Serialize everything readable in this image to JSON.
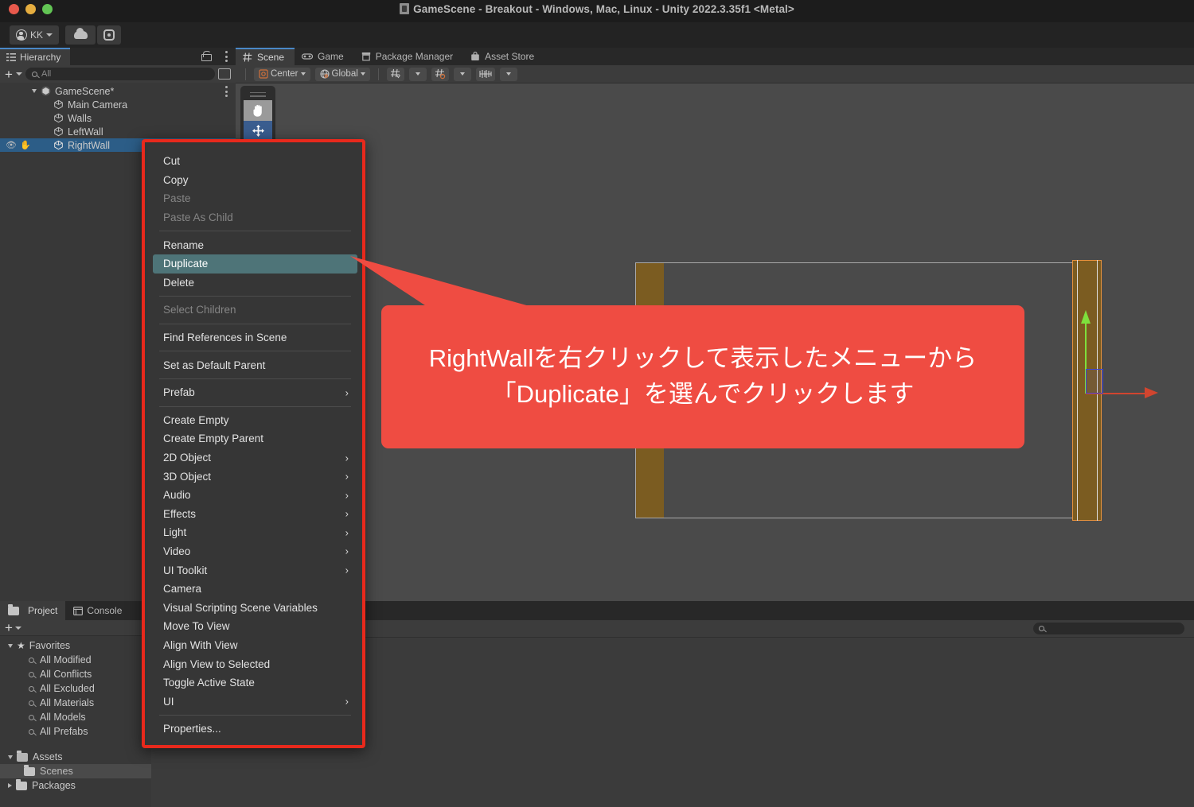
{
  "window": {
    "title": "GameScene - Breakout - Windows, Mac, Linux - Unity 2022.3.35f1 <Metal>",
    "doc_icon": "unity-document-icon"
  },
  "toolbar": {
    "account_label": "KK",
    "account_icon": "account-avatar-icon",
    "cloud_icon": "cloud-icon",
    "settings_icon": "gear-icon",
    "play_icon": "play-icon",
    "pause_icon": "pause-icon",
    "step_icon": "step-icon"
  },
  "hierarchy": {
    "tab_label": "Hierarchy",
    "tab_icon": "hierarchy-icon",
    "lock_icon": "lock-icon",
    "menu_icon": "kebab-menu-icon",
    "add_label": "+",
    "search_placeholder": "All",
    "search_value": "",
    "search_icon": "search-icon",
    "expand_icon": "open-in-new-icon",
    "items": [
      {
        "label": "GameScene*",
        "depth": 0,
        "icon": "unity-scene-icon",
        "expanded": true,
        "selected": false
      },
      {
        "label": "Main Camera",
        "depth": 1,
        "icon": "gameobject-cube-icon",
        "selected": false
      },
      {
        "label": "Walls",
        "depth": 1,
        "icon": "gameobject-cube-icon",
        "selected": false
      },
      {
        "label": "LeftWall",
        "depth": 1,
        "icon": "gameobject-cube-icon",
        "selected": false
      },
      {
        "label": "RightWall",
        "depth": 1,
        "icon": "gameobject-cube-icon",
        "selected": true
      }
    ]
  },
  "dock": {
    "tabs": [
      {
        "label": "Scene",
        "icon": "scene-grid-icon",
        "active": true
      },
      {
        "label": "Game",
        "icon": "gamepad-icon",
        "active": false
      },
      {
        "label": "Package Manager",
        "icon": "package-icon",
        "active": false
      },
      {
        "label": "Asset Store",
        "icon": "asset-store-bag-icon",
        "active": false
      }
    ],
    "scene_toolbar": {
      "pivot_mode": "Center",
      "pivot_icon": "pivot-center-icon",
      "handle_space": "Global",
      "handle_icon": "globe-icon",
      "grid_snapping_icon": "grid-snap-icon",
      "snap_increment_icon": "snap-increment-icon",
      "grid_visibility_icon": "grid-visibility-icon",
      "dropdown_icon": "chevron-down-icon"
    },
    "tool_palette": {
      "grip_icon": "drag-grip-icon",
      "hand_tool_icon": "hand-tool-icon",
      "move_tool_icon": "move-tool-icon",
      "active_tool": "move-tool"
    },
    "scene_objects": [
      {
        "name": "LeftWall",
        "color": "#7b5c21",
        "selected": false
      },
      {
        "name": "RightWall",
        "color": "#7b5c21",
        "selected": true,
        "outline": "#e6913c"
      }
    ],
    "gizmo": {
      "y_axis_color": "#7ee03c",
      "x_axis_color": "#d1452f",
      "plane_handle_color": "#3b46d6"
    }
  },
  "context_menu": {
    "border_color": "#e8291c",
    "highlight_color": "#4e7478",
    "items": [
      {
        "label": "Cut",
        "state": "normal"
      },
      {
        "label": "Copy",
        "state": "normal"
      },
      {
        "label": "Paste",
        "state": "disabled"
      },
      {
        "label": "Paste As Child",
        "state": "disabled"
      },
      {
        "separator": true
      },
      {
        "label": "Rename",
        "state": "normal"
      },
      {
        "label": "Duplicate",
        "state": "highlight"
      },
      {
        "label": "Delete",
        "state": "normal"
      },
      {
        "separator": true
      },
      {
        "label": "Select Children",
        "state": "disabled"
      },
      {
        "separator": true
      },
      {
        "label": "Find References in Scene",
        "state": "normal"
      },
      {
        "separator": true
      },
      {
        "label": "Set as Default Parent",
        "state": "normal"
      },
      {
        "separator": true
      },
      {
        "label": "Prefab",
        "state": "normal",
        "submenu": true
      },
      {
        "separator": true
      },
      {
        "label": "Create Empty",
        "state": "normal"
      },
      {
        "label": "Create Empty Parent",
        "state": "normal"
      },
      {
        "label": "2D Object",
        "state": "normal",
        "submenu": true
      },
      {
        "label": "3D Object",
        "state": "normal",
        "submenu": true
      },
      {
        "label": "Audio",
        "state": "normal",
        "submenu": true
      },
      {
        "label": "Effects",
        "state": "normal",
        "submenu": true
      },
      {
        "label": "Light",
        "state": "normal",
        "submenu": true
      },
      {
        "label": "Video",
        "state": "normal",
        "submenu": true
      },
      {
        "label": "UI Toolkit",
        "state": "normal",
        "submenu": true
      },
      {
        "label": "Camera",
        "state": "normal"
      },
      {
        "label": "Visual Scripting Scene Variables",
        "state": "normal"
      },
      {
        "label": "Move To View",
        "state": "normal"
      },
      {
        "label": "Align With View",
        "state": "normal"
      },
      {
        "label": "Align View to Selected",
        "state": "normal"
      },
      {
        "label": "Toggle Active State",
        "state": "normal"
      },
      {
        "label": "UI",
        "state": "normal",
        "submenu": true
      },
      {
        "separator": true
      },
      {
        "label": "Properties...",
        "state": "normal"
      }
    ],
    "submenu_glyph": "›"
  },
  "callout": {
    "background": "#ef4c42",
    "line1": "RightWallを右クリックして表示したメニューから",
    "line2": "「Duplicate」を選んでクリックします"
  },
  "project": {
    "tabs": [
      {
        "label": "Project",
        "icon": "folder-icon",
        "active": true
      },
      {
        "label": "Console",
        "icon": "console-icon",
        "active": false
      }
    ],
    "add_label": "+",
    "dropdown_icon": "chevron-down-icon",
    "items": [
      {
        "label": "Favorites",
        "depth": 0,
        "icon": "star-icon",
        "expanded": true
      },
      {
        "label": "All Modified",
        "depth": 1,
        "icon": "search-icon"
      },
      {
        "label": "All Conflicts",
        "depth": 1,
        "icon": "search-icon"
      },
      {
        "label": "All Excluded",
        "depth": 1,
        "icon": "search-icon"
      },
      {
        "label": "All Materials",
        "depth": 1,
        "icon": "search-icon"
      },
      {
        "label": "All Models",
        "depth": 1,
        "icon": "search-icon"
      },
      {
        "label": "All Prefabs",
        "depth": 1,
        "icon": "search-icon"
      },
      {
        "label": "",
        "depth": 0,
        "icon": "spacer"
      },
      {
        "label": "Assets",
        "depth": 0,
        "icon": "folder-open-icon",
        "expanded": true
      },
      {
        "label": "Scenes",
        "depth": 1,
        "icon": "folder-icon",
        "selected": true
      },
      {
        "label": "Packages",
        "depth": 0,
        "icon": "folder-icon",
        "collapsed": true
      }
    ]
  },
  "project_browser": {
    "search_placeholder": "",
    "search_value": "",
    "search_icon": "search-icon"
  }
}
